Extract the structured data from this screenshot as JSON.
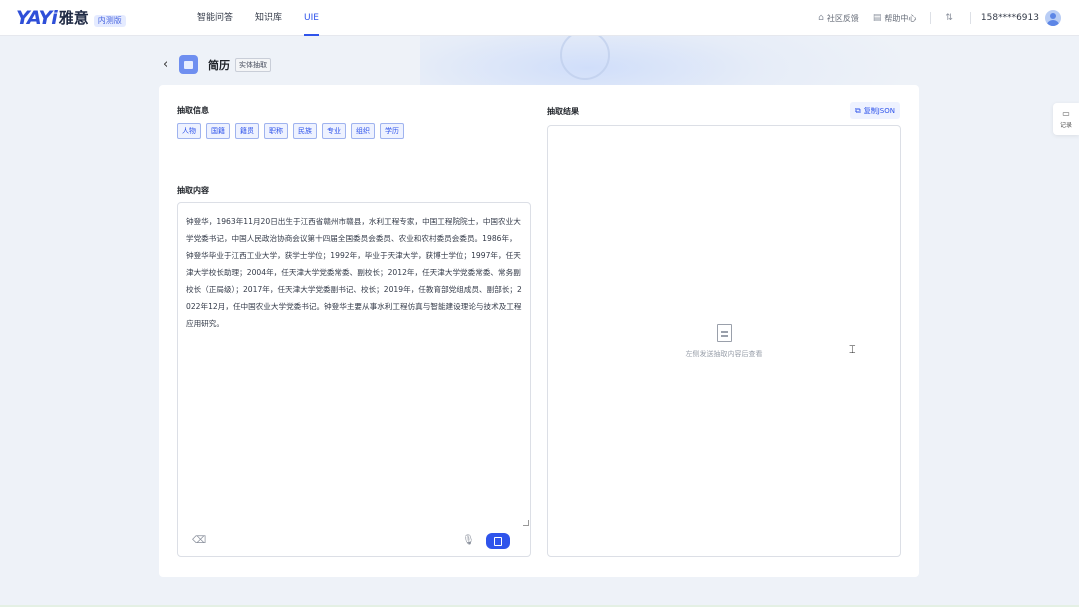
{
  "header": {
    "logo_mark": "YAYi",
    "logo_cn": "雅意",
    "logo_badge": "内测版",
    "nav": [
      {
        "label": "智能问答",
        "active": false
      },
      {
        "label": "知识库",
        "active": false
      },
      {
        "label": "UIE",
        "active": true
      }
    ],
    "feedback_label": "社区反馈",
    "feedback_icon": "home-icon",
    "help_label": "帮助中心",
    "help_icon": "doc-icon",
    "translate_icon": "translate-icon",
    "phone": "158****6913"
  },
  "page": {
    "back_icon": "chevron-left-icon",
    "title": "简历",
    "tag": "实体抽取"
  },
  "left": {
    "extract_info_label": "抽取信息",
    "tags": [
      "人物",
      "国籍",
      "籍贯",
      "职称",
      "民族",
      "专业",
      "组织",
      "学历"
    ],
    "content_label": "抽取内容",
    "content_text": "钟登华，1963年11月20日出生于江西省赣州市赣县，水利工程专家，中国工程院院士，中国农业大学党委书记，中国人民政治协商会议第十四届全国委员会委员、农业和农村委员会委员。1986年，钟登华毕业于江西工业大学，获学士学位；1992年，毕业于天津大学，获博士学位；1997年，任天津大学校长助理；2004年，任天津大学党委常委、副校长；2012年，任天津大学党委常委、常务副校长（正局级）；2017年，任天津大学党委副书记、校长；2019年，任教育部党组成员、副部长；2022年12月，任中国农业大学党委书记。钟登华主要从事水利工程仿真与智能建设理论与技术及工程应用研究。"
  },
  "right": {
    "result_label": "抽取结果",
    "copy_label": "复制JSON",
    "empty_text": "左侧发送抽取内容后查看"
  },
  "float": {
    "label": "记录"
  },
  "colors": {
    "accent": "#2f54eb",
    "background": "#eef2f8"
  }
}
